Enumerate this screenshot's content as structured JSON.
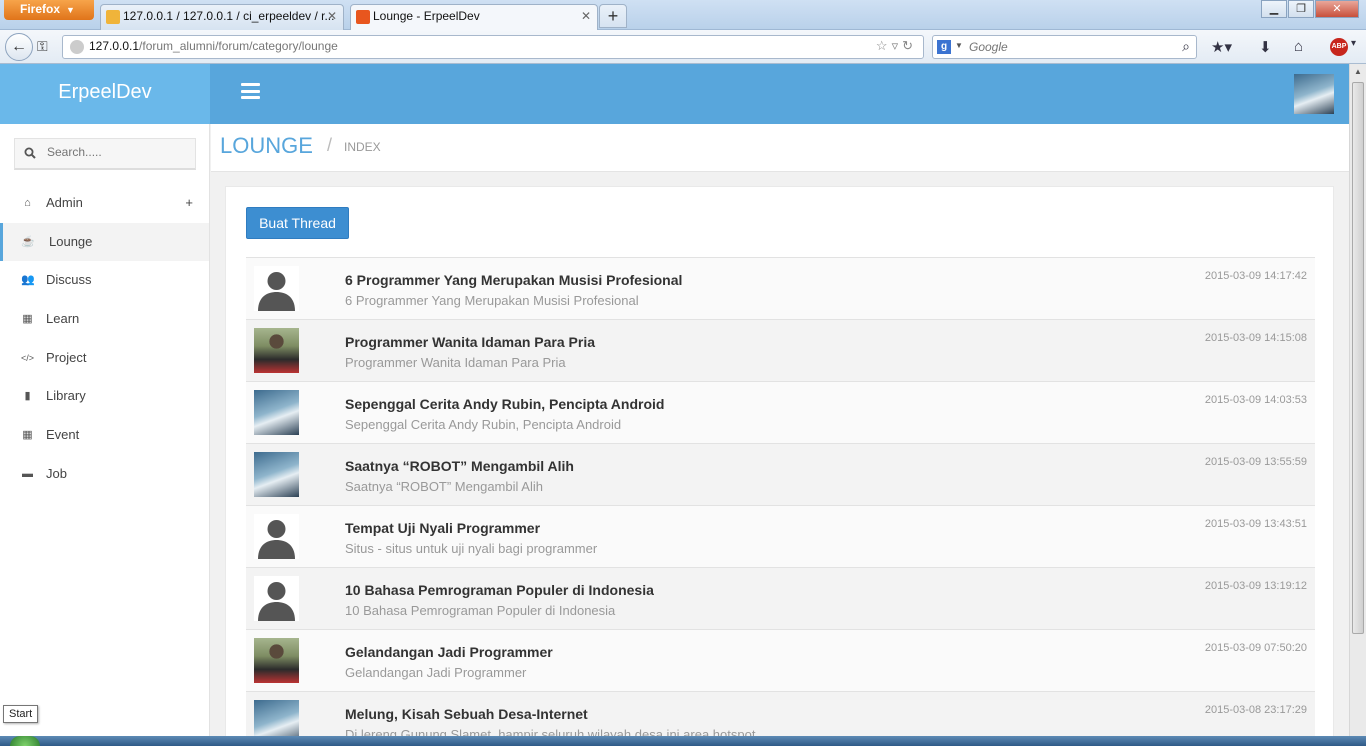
{
  "browser": {
    "menu_label": "Firefox",
    "tabs": [
      {
        "label": "127.0.0.1 / 127.0.0.1 / ci_erpeeldev / r...",
        "active": false
      },
      {
        "label": "Lounge - ErpeelDev",
        "active": true
      }
    ],
    "new_tab_label": "+",
    "url_host": "127.0.0.1",
    "url_path": "/forum_alumni/forum/category/lounge",
    "search_placeholder": "Google",
    "search_engine_letter": "g",
    "adblock_label": "ABP"
  },
  "app": {
    "brand": "ErpeelDev",
    "accent": "#58a6dc"
  },
  "sidebar": {
    "search_placeholder": "Search.....",
    "items": [
      {
        "label": "Admin",
        "icon": "home-icon",
        "glyph": "⌂",
        "has_plus": true,
        "active": false
      },
      {
        "label": "Lounge",
        "icon": "coffee-icon",
        "glyph": "☕",
        "active": true
      },
      {
        "label": "Discuss",
        "icon": "users-icon",
        "glyph": "👥",
        "active": false
      },
      {
        "label": "Learn",
        "icon": "grid-icon",
        "glyph": "▦",
        "active": false
      },
      {
        "label": "Project",
        "icon": "code-icon",
        "glyph": "</>",
        "active": false
      },
      {
        "label": "Library",
        "icon": "book-icon",
        "glyph": "▮",
        "active": false
      },
      {
        "label": "Event",
        "icon": "calendar-icon",
        "glyph": "▦",
        "active": false
      },
      {
        "label": "Job",
        "icon": "briefcase-icon",
        "glyph": "▬",
        "active": false
      }
    ],
    "plus_label": "+"
  },
  "breadcrumb": {
    "title": "LOUNGE",
    "separator": "/",
    "current": "INDEX"
  },
  "main": {
    "create_button": "Buat Thread",
    "threads": [
      {
        "title": "6 Programmer Yang Merupakan Musisi Profesional",
        "subtitle": "6 Programmer Yang Merupakan Musisi Profesional",
        "date": "2015-03-09 14:17:42",
        "avatar": "default"
      },
      {
        "title": "Programmer Wanita Idaman Para Pria",
        "subtitle": "Programmer Wanita Idaman Para Pria",
        "date": "2015-03-09 14:15:08",
        "avatar": "photo-a"
      },
      {
        "title": "Sepenggal Cerita Andy Rubin, Pencipta Android",
        "subtitle": "Sepenggal Cerita Andy Rubin, Pencipta Android",
        "date": "2015-03-09 14:03:53",
        "avatar": "photo-b"
      },
      {
        "title": "Saatnya “ROBOT” Mengambil Alih",
        "subtitle": "Saatnya “ROBOT” Mengambil Alih",
        "date": "2015-03-09 13:55:59",
        "avatar": "photo-b"
      },
      {
        "title": "Tempat Uji Nyali Programmer",
        "subtitle": "Situs - situs untuk uji nyali bagi programmer",
        "date": "2015-03-09 13:43:51",
        "avatar": "default"
      },
      {
        "title": "10 Bahasa Pemrograman Populer di Indonesia",
        "subtitle": "10 Bahasa Pemrograman Populer di Indonesia",
        "date": "2015-03-09 13:19:12",
        "avatar": "default"
      },
      {
        "title": "Gelandangan Jadi Programmer",
        "subtitle": "Gelandangan Jadi Programmer",
        "date": "2015-03-09 07:50:20",
        "avatar": "photo-a"
      },
      {
        "title": "Melung, Kisah Sebuah Desa-Internet",
        "subtitle": "Di lereng Gunung Slamet, hampir seluruh wilayah desa ini area hotspot.",
        "date": "2015-03-08 23:17:29",
        "avatar": "photo-b"
      }
    ]
  },
  "taskbar": {
    "start_tooltip": "Start"
  }
}
